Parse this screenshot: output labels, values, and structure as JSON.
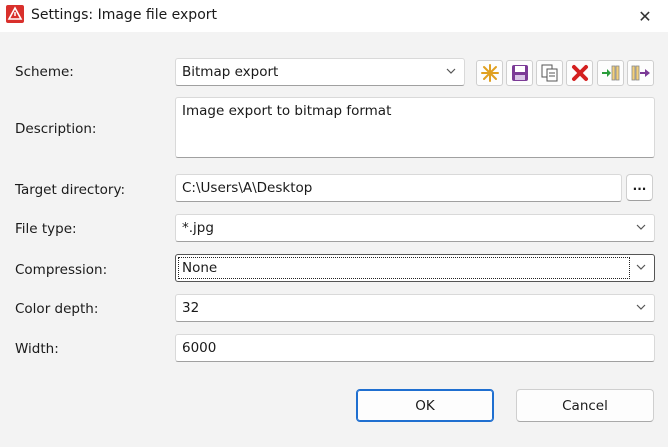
{
  "window": {
    "title": "Settings: Image file export",
    "close_glyph": "✕"
  },
  "form": {
    "scheme": {
      "label": "Scheme:",
      "value": "Bitmap export"
    },
    "description": {
      "label": "Description:",
      "value": "Image export to bitmap format"
    },
    "target_directory": {
      "label": "Target directory:",
      "value": "C:\\Users\\A\\Desktop",
      "browse_label": "..."
    },
    "file_type": {
      "label": "File type:",
      "value": "*.jpg"
    },
    "compression": {
      "label": "Compression:",
      "value": "None"
    },
    "color_depth": {
      "label": "Color depth:",
      "value": "32"
    },
    "width": {
      "label": "Width:",
      "value": "6000"
    }
  },
  "toolbar": {
    "icons": [
      "new-scheme-icon",
      "save-scheme-icon",
      "copy-scheme-icon",
      "delete-scheme-icon",
      "import-scheme-icon",
      "export-scheme-icon"
    ]
  },
  "buttons": {
    "ok": "OK",
    "cancel": "Cancel"
  },
  "colors": {
    "accent": "#1f6fd0",
    "app_icon": "#d9302c",
    "new_icon": "#e0a020",
    "save_icon": "#7b3a96",
    "delete_icon": "#d42020"
  }
}
